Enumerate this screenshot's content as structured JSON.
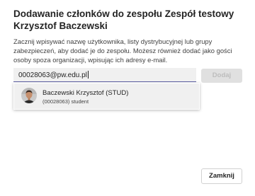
{
  "dialog": {
    "title": "Dodawanie członków do zespołu Zespół testowy Krzysztof Baczewski",
    "description": "Zacznij wpisywać nazwę użytkownika, listy dystrybucyjnej lub grupy zabezpieczeń, aby dodać je do zespołu. Możesz również dodać jako gości osoby spoza organizacji, wpisując ich adresy e-mail.",
    "input_value": "00028063@pw.edu.pl",
    "add_label": "Dodaj",
    "close_label": "Zamknij"
  },
  "suggestion": {
    "name": "Baczewski Krzysztof (STUD)",
    "subtitle": "(00028063) student"
  }
}
